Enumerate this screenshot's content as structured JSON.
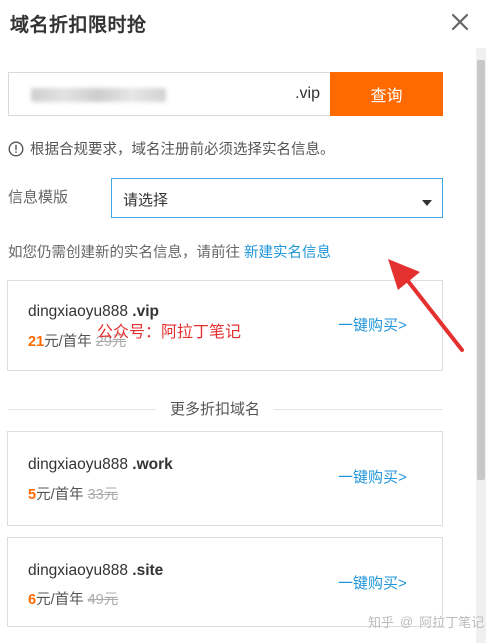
{
  "dialog": {
    "title": "域名折扣限时抢"
  },
  "search": {
    "suffix": ".vip",
    "button_label": "查询"
  },
  "notice": {
    "text": "根据合规要求，域名注册前必须选择实名信息。"
  },
  "template": {
    "label": "信息模版",
    "select_value": "请选择"
  },
  "hint": {
    "text": "如您仍需创建新的实名信息，请前往 ",
    "link": "新建实名信息"
  },
  "primary_offer": {
    "name": "dingxiaoyu888",
    "suffix": " .vip",
    "price": "21",
    "unit": "元/首年",
    "old_price": "29元",
    "buy_label": "一键购买>"
  },
  "watermark_overlay": "公众号：阿拉丁笔记",
  "more_section": {
    "title": "更多折扣域名"
  },
  "offers": [
    {
      "name": "dingxiaoyu888",
      "suffix": " .work",
      "price": "5",
      "unit": "元/首年",
      "old_price": "33元",
      "buy_label": "一键购买>"
    },
    {
      "name": "dingxiaoyu888",
      "suffix": " .site",
      "price": "6",
      "unit": "元/首年",
      "old_price": "49元",
      "buy_label": "一键购买>"
    }
  ],
  "platform_watermark": {
    "site": "知乎",
    "author": "阿拉丁笔记"
  },
  "colors": {
    "accent": "#ff6a00",
    "link": "#1e96d8",
    "select_border": "#40a9e6",
    "annotation_red": "#e53030"
  }
}
